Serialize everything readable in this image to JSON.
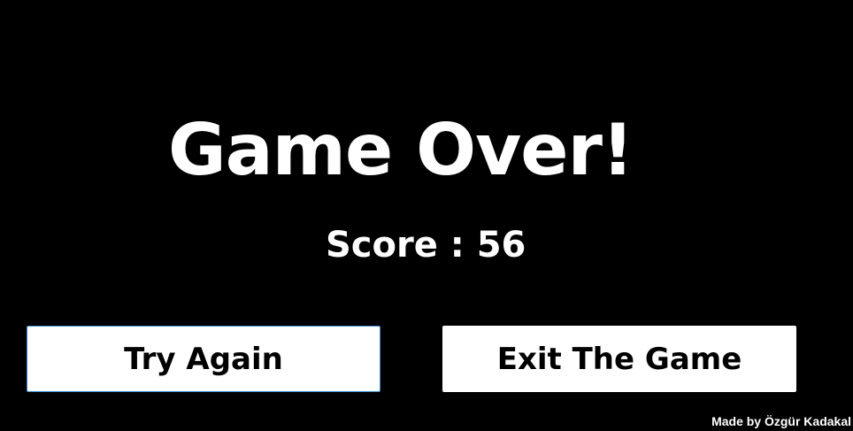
{
  "game_over": {
    "title": "Game Over!",
    "score_text": "Score : 56",
    "score_value": 56
  },
  "buttons": {
    "try_again_label": "Try Again",
    "exit_label": "Exit The Game"
  },
  "footer": {
    "credit": "Made by Özgür Kadakal"
  },
  "colors": {
    "background": "#000000",
    "text": "#ffffff",
    "button_background": "#ffffff",
    "button_text": "#000000",
    "focus_border": "#3a8fd6"
  }
}
